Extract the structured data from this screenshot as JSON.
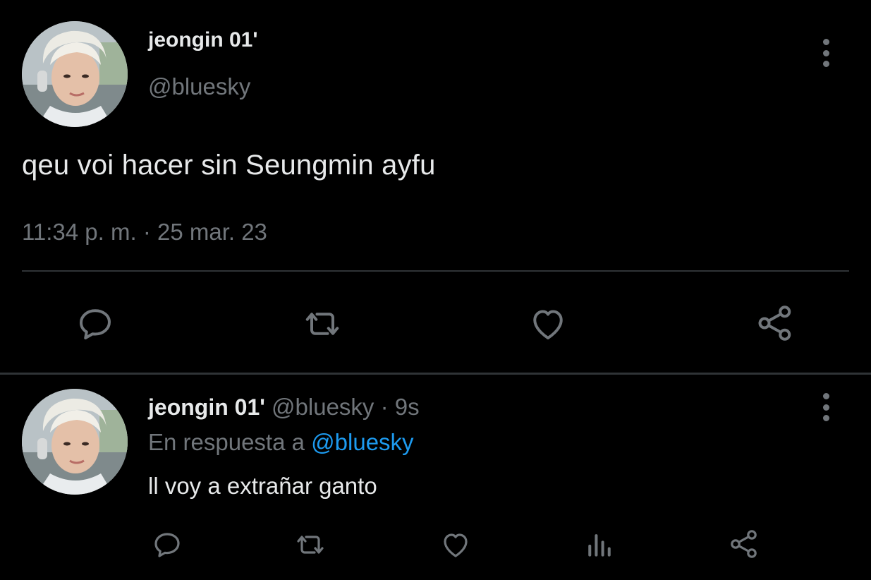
{
  "main_tweet": {
    "display_name": "jeongin 01'",
    "handle": "@bluesky",
    "text": "qeu voi hacer sin Seungmin ayfu",
    "timestamp": "11:34 p. m. · 25 mar. 23",
    "actions": [
      "reply-icon",
      "retweet-icon",
      "like-icon",
      "share-icon"
    ]
  },
  "reply_tweet": {
    "display_name": "jeongin 01'",
    "handle": "@bluesky",
    "separator": " · ",
    "time": "9s",
    "reply_to_prefix": "En respuesta a ",
    "reply_to_mention": "@bluesky",
    "text": "ll voy a extrañar ganto",
    "actions": [
      "reply-icon",
      "retweet-icon",
      "like-icon",
      "views-icon",
      "share-icon"
    ]
  },
  "colors": {
    "background": "#000000",
    "primary_text": "#e7e9ea",
    "secondary_text": "#71767b",
    "mention": "#1d9bf0",
    "divider": "#2f3336"
  }
}
